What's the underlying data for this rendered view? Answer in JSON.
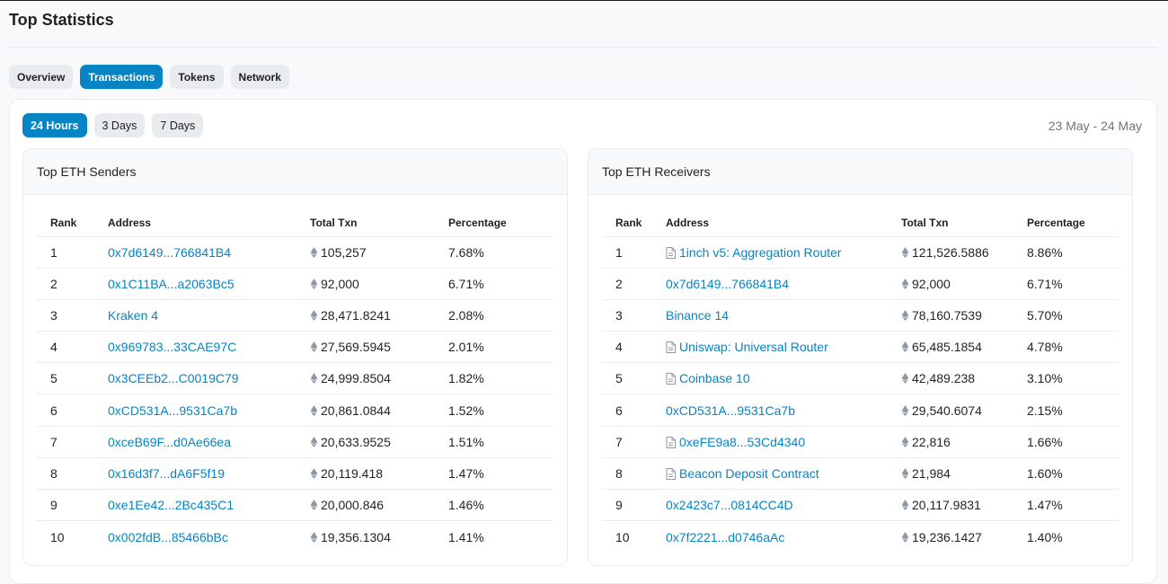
{
  "page": {
    "title": "Top Statistics"
  },
  "tabs": [
    {
      "label": "Overview",
      "active": false
    },
    {
      "label": "Transactions",
      "active": true
    },
    {
      "label": "Tokens",
      "active": false
    },
    {
      "label": "Network",
      "active": false
    }
  ],
  "ranges": [
    {
      "label": "24 Hours",
      "active": true
    },
    {
      "label": "3 Days",
      "active": false
    },
    {
      "label": "7 Days",
      "active": false
    }
  ],
  "date_range": "23 May - 24 May",
  "columns": {
    "rank": "Rank",
    "address": "Address",
    "total": "Total Txn",
    "pct": "Percentage"
  },
  "senders": {
    "title": "Top ETH Senders",
    "rows": [
      {
        "rank": "1",
        "address": "0x7d6149...766841B4",
        "contract": false,
        "total": "105,257",
        "pct": "7.68%"
      },
      {
        "rank": "2",
        "address": "0x1C11BA...a2063Bc5",
        "contract": false,
        "total": "92,000",
        "pct": "6.71%"
      },
      {
        "rank": "3",
        "address": "Kraken 4",
        "contract": false,
        "total": "28,471.8241",
        "pct": "2.08%"
      },
      {
        "rank": "4",
        "address": "0x969783...33CAE97C",
        "contract": false,
        "total": "27,569.5945",
        "pct": "2.01%"
      },
      {
        "rank": "5",
        "address": "0x3CEEb2...C0019C79",
        "contract": false,
        "total": "24,999.8504",
        "pct": "1.82%"
      },
      {
        "rank": "6",
        "address": "0xCD531A...9531Ca7b",
        "contract": false,
        "total": "20,861.0844",
        "pct": "1.52%"
      },
      {
        "rank": "7",
        "address": "0xceB69F...d0Ae66ea",
        "contract": false,
        "total": "20,633.9525",
        "pct": "1.51%"
      },
      {
        "rank": "8",
        "address": "0x16d3f7...dA6F5f19",
        "contract": false,
        "total": "20,119.418",
        "pct": "1.47%"
      },
      {
        "rank": "9",
        "address": "0xe1Ee42...2Bc435C1",
        "contract": false,
        "total": "20,000.846",
        "pct": "1.46%"
      },
      {
        "rank": "10",
        "address": "0x002fdB...85466bBc",
        "contract": false,
        "total": "19,356.1304",
        "pct": "1.41%"
      }
    ]
  },
  "receivers": {
    "title": "Top ETH Receivers",
    "rows": [
      {
        "rank": "1",
        "address": "1inch v5: Aggregation Router",
        "contract": true,
        "total": "121,526.5886",
        "pct": "8.86%"
      },
      {
        "rank": "2",
        "address": "0x7d6149...766841B4",
        "contract": false,
        "total": "92,000",
        "pct": "6.71%"
      },
      {
        "rank": "3",
        "address": "Binance 14",
        "contract": false,
        "total": "78,160.7539",
        "pct": "5.70%"
      },
      {
        "rank": "4",
        "address": "Uniswap: Universal Router",
        "contract": true,
        "total": "65,485.1854",
        "pct": "4.78%"
      },
      {
        "rank": "5",
        "address": "Coinbase 10",
        "contract": true,
        "total": "42,489.238",
        "pct": "3.10%"
      },
      {
        "rank": "6",
        "address": "0xCD531A...9531Ca7b",
        "contract": false,
        "total": "29,540.6074",
        "pct": "2.15%"
      },
      {
        "rank": "7",
        "address": "0xeFE9a8...53Cd4340",
        "contract": true,
        "total": "22,816",
        "pct": "1.66%"
      },
      {
        "rank": "8",
        "address": "Beacon Deposit Contract",
        "contract": true,
        "total": "21,984",
        "pct": "1.60%"
      },
      {
        "rank": "9",
        "address": "0x2423c7...0814CC4D",
        "contract": false,
        "total": "20,117.9831",
        "pct": "1.47%"
      },
      {
        "rank": "10",
        "address": "0x7f2221...d0746aAc",
        "contract": false,
        "total": "19,236.1427",
        "pct": "1.40%"
      }
    ]
  },
  "colors": {
    "accent": "#0784c3",
    "link": "#0784c3",
    "muted": "#6c757d"
  },
  "icons": {
    "eth": "ethereum-icon",
    "contract": "document-icon"
  }
}
